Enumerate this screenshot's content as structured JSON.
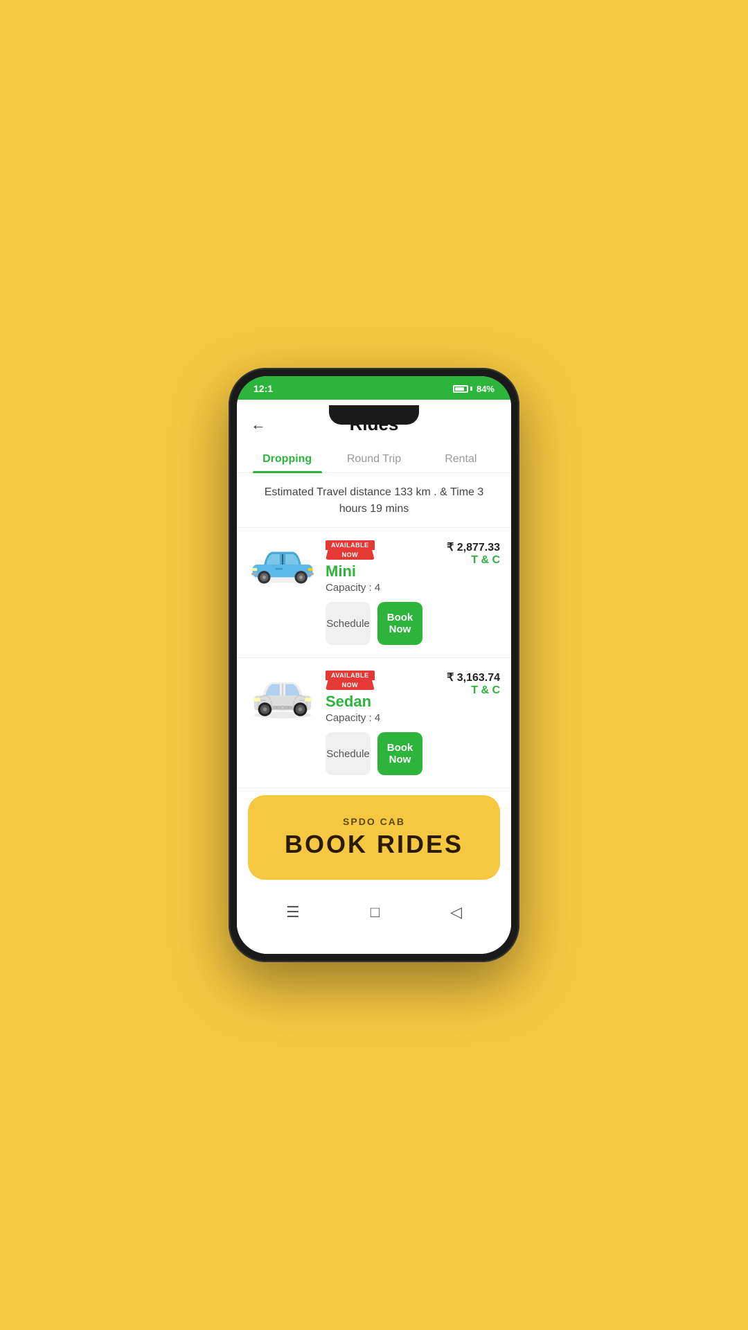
{
  "statusBar": {
    "time": "12:1",
    "battery": "84%"
  },
  "header": {
    "title": "Rides",
    "back_label": "←"
  },
  "tabs": [
    {
      "id": "dropping",
      "label": "Dropping",
      "active": true
    },
    {
      "id": "round-trip",
      "label": "Round Trip",
      "active": false
    },
    {
      "id": "rental",
      "label": "Rental",
      "active": false
    }
  ],
  "travelInfo": "Estimated Travel distance 133 km . & Time 3 hours 19 mins",
  "rides": [
    {
      "id": "mini",
      "available_top": "AVAILABLE",
      "available_now": "NOW",
      "name": "Mini",
      "capacity": "Capacity : 4",
      "price": "₹ 2,877.33",
      "tc": "T & C",
      "schedule_label": "Schedule",
      "book_label": "Book Now",
      "car_type": "mini"
    },
    {
      "id": "sedan",
      "available_top": "AVAILABLE",
      "available_now": "NOW",
      "name": "Sedan",
      "capacity": "Capacity : 4",
      "price": "₹ 3,163.74",
      "tc": "T & C",
      "schedule_label": "Schedule",
      "book_label": "Book Now",
      "car_type": "sedan"
    }
  ],
  "banner": {
    "subtitle": "SPDO CAB",
    "title": "BOOK RIDES"
  },
  "bottomNav": {
    "menu_icon": "☰",
    "home_icon": "□",
    "back_icon": "◁"
  }
}
